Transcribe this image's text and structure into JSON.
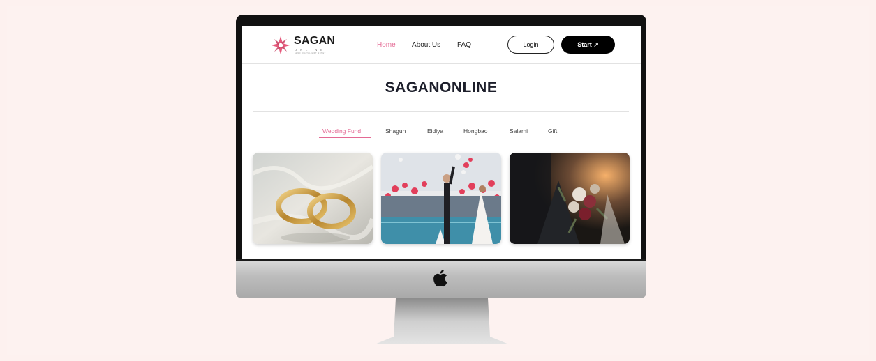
{
  "brand": {
    "name": "SAGAN",
    "sub": "ONLINE",
    "tagline": "SEND DIGITAL GIFT MONEY"
  },
  "nav": {
    "links": [
      "Home",
      "About Us",
      "FAQ"
    ],
    "active": "Home",
    "login_label": "Login",
    "start_label": "Start ↗"
  },
  "hero": {
    "title": "SAGANONLINE"
  },
  "tabs": {
    "items": [
      "Wedding Fund",
      "Shagun",
      "Eidiya",
      "Hongbao",
      "Salami",
      "Gift"
    ],
    "active": "Wedding Fund"
  },
  "cards": [
    {
      "image": "wedding-rings-photo"
    },
    {
      "image": "wedding-couple-balloons-photo"
    },
    {
      "image": "bridal-bouquet-photo"
    }
  ],
  "colors": {
    "accent": "#e46a94",
    "page_background": "#fdf1ef",
    "title": "#1d1f2b"
  }
}
